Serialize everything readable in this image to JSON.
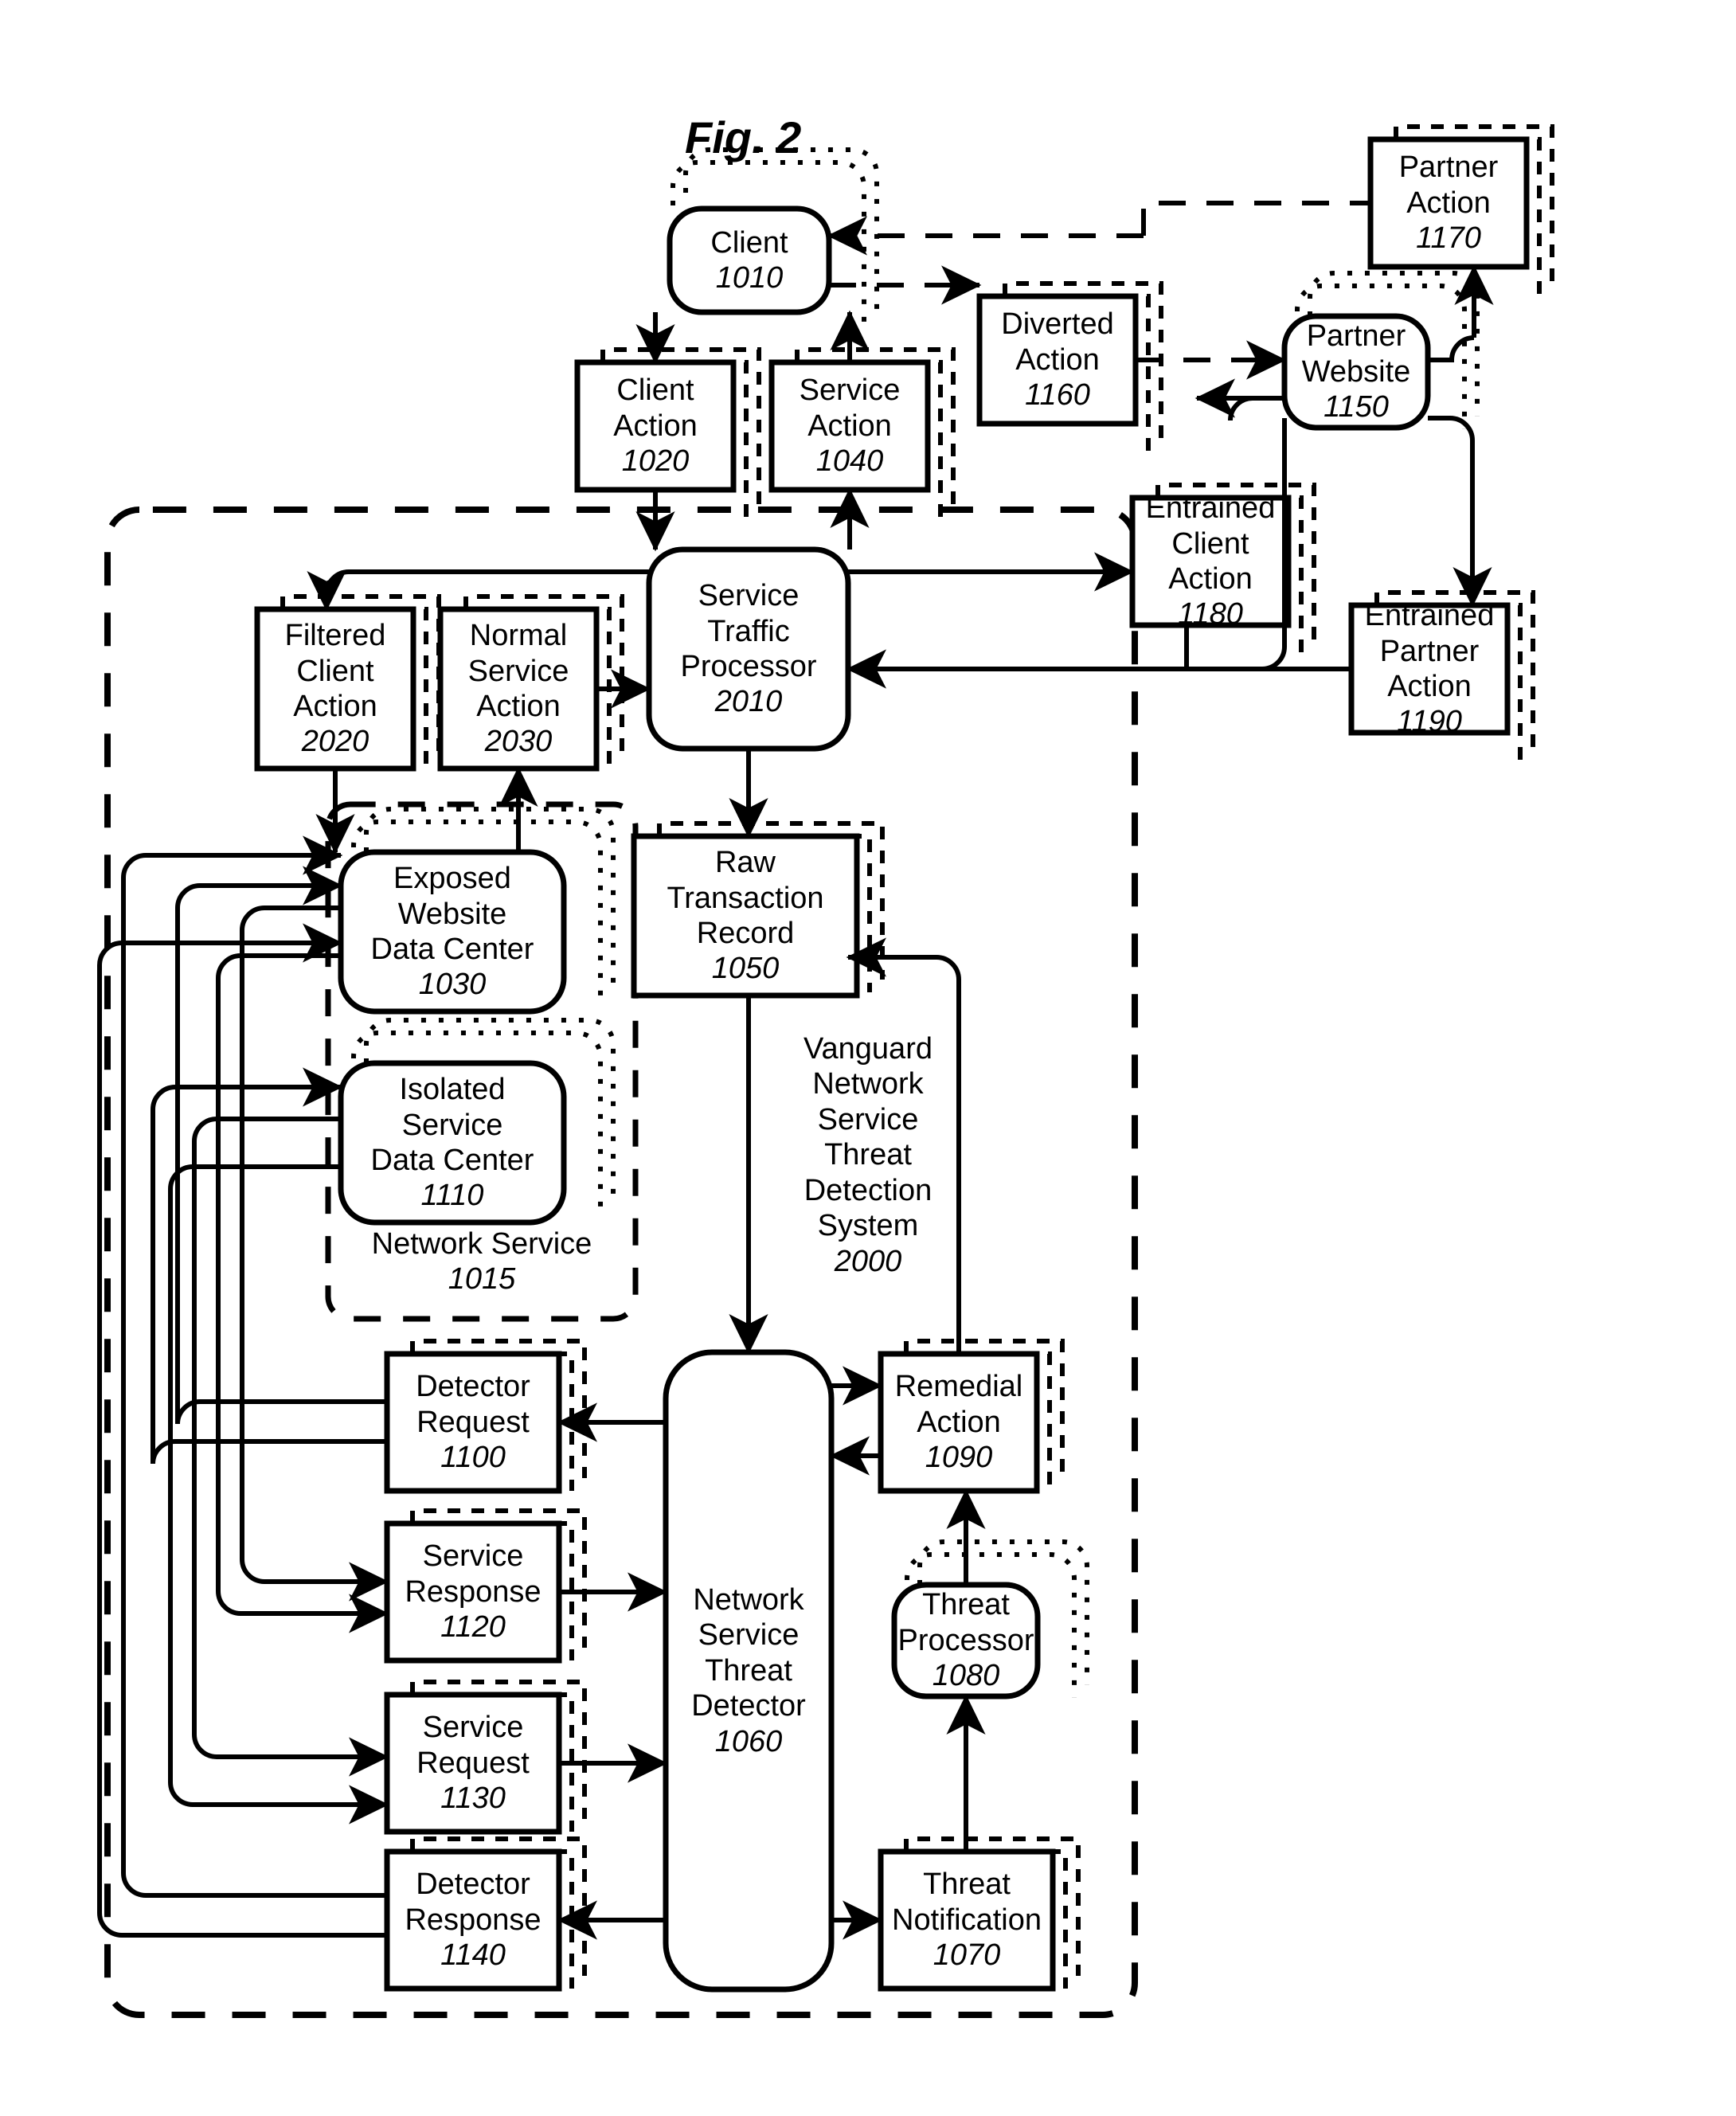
{
  "figure": {
    "title": "Fig. 2",
    "kind": "patent-flow-diagram"
  },
  "boundaries": [
    {
      "id": "system",
      "label": "Vanguard Network Service Threat Detection System",
      "number": "2000",
      "style": "dashed"
    },
    {
      "id": "network_service",
      "label": "Network Service",
      "number": "1015",
      "style": "dashed"
    }
  ],
  "nodes": [
    {
      "id": "client",
      "label": "Client",
      "label2": "",
      "label3": "",
      "number": "1010",
      "shape": "rounded",
      "stacked": "dotted"
    },
    {
      "id": "client_action",
      "label": "Client",
      "label2": "Action",
      "label3": "",
      "number": "1020",
      "shape": "rect",
      "stacked": "dashed"
    },
    {
      "id": "service_action",
      "label": "Service",
      "label2": "Action",
      "label3": "",
      "number": "1040",
      "shape": "rect",
      "stacked": "dashed"
    },
    {
      "id": "diverted_action",
      "label": "Diverted",
      "label2": "Action",
      "label3": "",
      "number": "1160",
      "shape": "rect",
      "stacked": "dashed"
    },
    {
      "id": "partner_website",
      "label": "Partner",
      "label2": "Website",
      "label3": "",
      "number": "1150",
      "shape": "rounded",
      "stacked": "dotted"
    },
    {
      "id": "partner_action",
      "label": "Partner",
      "label2": "Action",
      "label3": "",
      "number": "1170",
      "shape": "rect",
      "stacked": "dashed"
    },
    {
      "id": "entrained_client",
      "label": "Entrained",
      "label2": "Client",
      "label3": "Action",
      "number": "1180",
      "shape": "rect",
      "stacked": "dashed"
    },
    {
      "id": "entrained_partner",
      "label": "Entrained",
      "label2": "Partner",
      "label3": "Action",
      "number": "1190",
      "shape": "rect",
      "stacked": "dashed"
    },
    {
      "id": "stp",
      "label": "Service",
      "label2": "Traffic",
      "label3": "Processor",
      "number": "2010",
      "shape": "rounded",
      "stacked": "none"
    },
    {
      "id": "filtered_client",
      "label": "Filtered",
      "label2": "Client",
      "label3": "Action",
      "number": "2020",
      "shape": "rect",
      "stacked": "dashed"
    },
    {
      "id": "normal_service",
      "label": "Normal",
      "label2": "Service",
      "label3": "Action",
      "number": "2030",
      "shape": "rect",
      "stacked": "dashed"
    },
    {
      "id": "exposed_dc",
      "label": "Exposed",
      "label2": "Website",
      "label3": "Data Center",
      "number": "1030",
      "shape": "rounded",
      "stacked": "dotted"
    },
    {
      "id": "isolated_dc",
      "label": "Isolated",
      "label2": "Service",
      "label3": "Data Center",
      "number": "1110",
      "shape": "rounded",
      "stacked": "dotted"
    },
    {
      "id": "raw_txn",
      "label": "Raw",
      "label2": "Transaction",
      "label3": "Record",
      "number": "1050",
      "shape": "rect",
      "stacked": "dashed"
    },
    {
      "id": "detector_request",
      "label": "Detector",
      "label2": "Request",
      "label3": "",
      "number": "1100",
      "shape": "rect",
      "stacked": "dashed"
    },
    {
      "id": "service_response",
      "label": "Service",
      "label2": "Response",
      "label3": "",
      "number": "1120",
      "shape": "rect",
      "stacked": "dashed"
    },
    {
      "id": "service_request",
      "label": "Service",
      "label2": "Request",
      "label3": "",
      "number": "1130",
      "shape": "rect",
      "stacked": "dashed"
    },
    {
      "id": "detector_response",
      "label": "Detector",
      "label2": "Response",
      "label3": "",
      "number": "1140",
      "shape": "rect",
      "stacked": "dashed"
    },
    {
      "id": "nstd",
      "label": "Network",
      "label2": "Service",
      "label3": "Threat",
      "label4": "Detector",
      "number": "1060",
      "shape": "rounded",
      "stacked": "none"
    },
    {
      "id": "remedial_action",
      "label": "Remedial",
      "label2": "Action",
      "label3": "",
      "number": "1090",
      "shape": "rect",
      "stacked": "dashed"
    },
    {
      "id": "threat_processor",
      "label": "Threat",
      "label2": "Processor",
      "label3": "",
      "number": "1080",
      "shape": "rounded",
      "stacked": "dotted"
    },
    {
      "id": "threat_notification",
      "label": "Threat",
      "label2": "Notification",
      "label3": "",
      "number": "1070",
      "shape": "rect",
      "stacked": "dashed"
    }
  ],
  "colors": {
    "stroke": "#000000",
    "background": "#ffffff"
  }
}
